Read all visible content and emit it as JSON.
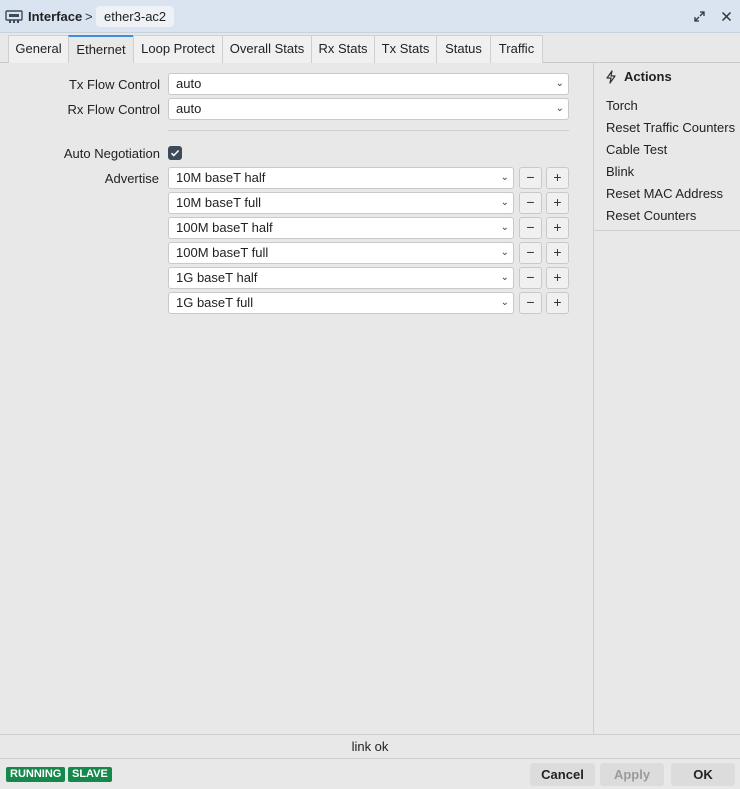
{
  "window": {
    "breadcrumb_root": "Interface",
    "breadcrumb_sep": ">",
    "breadcrumb_current": "ether3-ac2"
  },
  "tabs": [
    {
      "label": "General"
    },
    {
      "label": "Ethernet",
      "active": true
    },
    {
      "label": "Loop Protect"
    },
    {
      "label": "Overall Stats"
    },
    {
      "label": "Rx Stats"
    },
    {
      "label": "Tx Stats"
    },
    {
      "label": "Status"
    },
    {
      "label": "Traffic"
    }
  ],
  "form": {
    "tx_flow_control": {
      "label": "Tx Flow Control",
      "value": "auto"
    },
    "rx_flow_control": {
      "label": "Rx Flow Control",
      "value": "auto"
    },
    "auto_negotiation": {
      "label": "Auto Negotiation",
      "checked": true
    },
    "advertise": {
      "label": "Advertise",
      "items": [
        "10M baseT half",
        "10M baseT full",
        "100M baseT half",
        "100M baseT full",
        "1G baseT half",
        "1G baseT full"
      ],
      "remove_glyph": "−",
      "add_glyph": "+"
    }
  },
  "actions": {
    "title": "Actions",
    "items": [
      "Torch",
      "Reset Traffic Counters",
      "Cable Test",
      "Blink",
      "Reset MAC Address",
      "Reset Counters"
    ]
  },
  "status_text": "link ok",
  "badges": [
    "RUNNING",
    "SLAVE"
  ],
  "buttons": {
    "cancel": "Cancel",
    "apply": "Apply",
    "ok": "OK"
  },
  "colors": {
    "accent": "#3a8fd8",
    "badge": "#14894b",
    "titlebar": "#d9e4f0"
  }
}
